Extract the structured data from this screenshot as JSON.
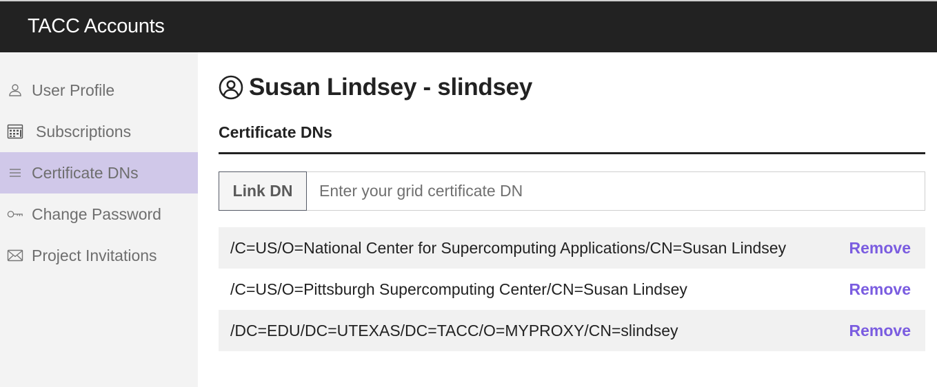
{
  "header": {
    "app_title": "TACC Accounts"
  },
  "sidebar": {
    "items": [
      {
        "label": "User Profile",
        "icon": "user-icon",
        "active": false
      },
      {
        "label": "Subscriptions",
        "icon": "calculator-icon",
        "active": false
      },
      {
        "label": "Certificate DNs",
        "icon": "list-icon",
        "active": true
      },
      {
        "label": "Change Password",
        "icon": "key-icon",
        "active": false
      },
      {
        "label": "Project Invitations",
        "icon": "envelope-icon",
        "active": false
      }
    ]
  },
  "main": {
    "page_title": "Susan Lindsey - slindsey",
    "title_icon": "user-circle-icon",
    "section_title": "Certificate DNs",
    "link_button_label": "Link DN",
    "dn_input": {
      "value": "",
      "placeholder": "Enter your grid certificate DN"
    },
    "dns": [
      {
        "dn": "/C=US/O=National Center for Supercomputing Applications/CN=Susan Lindsey",
        "action": "Remove"
      },
      {
        "dn": "/C=US/O=Pittsburgh Supercomputing Center/CN=Susan Lindsey",
        "action": "Remove"
      },
      {
        "dn": "/DC=EDU/DC=UTEXAS/DC=TACC/O=MYPROXY/CN=slindsey",
        "action": "Remove"
      }
    ]
  },
  "colors": {
    "topbar": "#222222",
    "sidebar_bg": "#f3f3f3",
    "sidebar_active": "#d0c8e9",
    "link_accent": "#7a5ce0",
    "row_shade": "#f1f1f1"
  }
}
